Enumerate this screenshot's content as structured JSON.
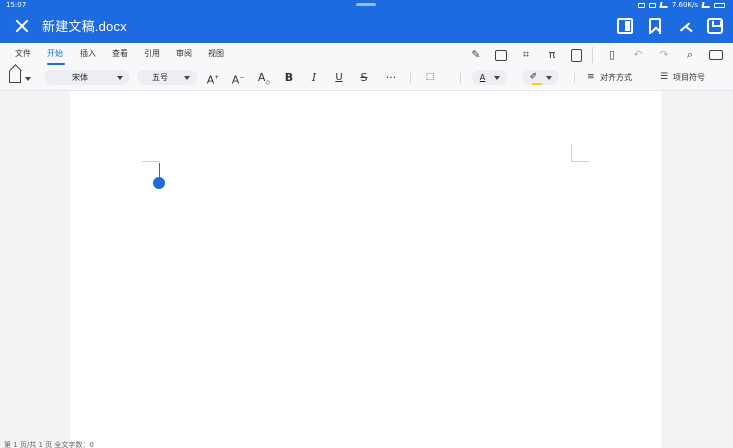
{
  "status_bar": {
    "time": "15:07",
    "network_speed": "7.60K/s"
  },
  "title_bar": {
    "doc_title": "新建文稿.docx"
  },
  "menu": {
    "tabs": [
      {
        "label": "文件",
        "active": false
      },
      {
        "label": "开始",
        "active": true
      },
      {
        "label": "插入",
        "active": false
      },
      {
        "label": "查看",
        "active": false
      },
      {
        "label": "引用",
        "active": false
      },
      {
        "label": "审阅",
        "active": false
      },
      {
        "label": "视图",
        "active": false
      }
    ],
    "pi_symbol": "π"
  },
  "toolbar": {
    "font_name": "宋体",
    "font_size": "五号",
    "grow_font": "A",
    "shrink_font": "A",
    "clear_format": "A",
    "bold": "B",
    "italic": "I",
    "underline": "U",
    "strike": "S",
    "more": "···",
    "font_color_letter": "A",
    "align_label": "对齐方式",
    "list_label": "项目符号"
  },
  "colors": {
    "accent": "#1c6be0",
    "font_color": "#222222",
    "highlight": "#f2d600"
  },
  "footer": {
    "status_text": "第 1 页/共 1 页    全文字数：0"
  }
}
